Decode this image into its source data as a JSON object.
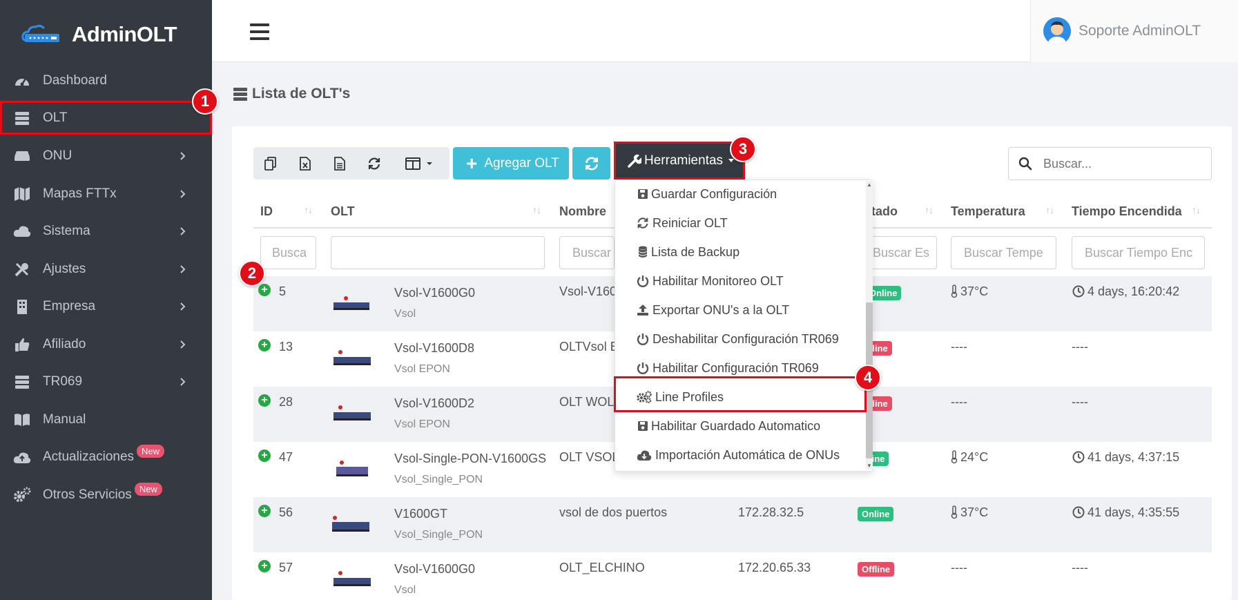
{
  "app": {
    "brand": "AdminOLT",
    "user_name": "Soporte AdminOLT"
  },
  "sidebar": {
    "items": [
      {
        "label": "Dashboard",
        "icon": "tachometer-icon"
      },
      {
        "label": "OLT",
        "icon": "server-icon"
      },
      {
        "label": "ONU",
        "icon": "router-icon"
      },
      {
        "label": "Mapas FTTx",
        "icon": "map-icon"
      },
      {
        "label": "Sistema",
        "icon": "cloud-icon"
      },
      {
        "label": "Ajustes",
        "icon": "tools-icon"
      },
      {
        "label": "Empresa",
        "icon": "building-icon"
      },
      {
        "label": "Afiliado",
        "icon": "thumbs-up-icon"
      },
      {
        "label": "TR069",
        "icon": "server-icon"
      },
      {
        "label": "Manual",
        "icon": "book-icon"
      },
      {
        "label": "Actualizaciones",
        "icon": "cloud-upload-icon",
        "badge": "New"
      },
      {
        "label": "Otros Servicios",
        "icon": "gears-icon",
        "badge": "New"
      }
    ]
  },
  "page": {
    "title": "Lista de OLT's"
  },
  "toolbar": {
    "add_label": "Agregar OLT",
    "tools_label": "Herramientas",
    "search_placeholder": "Buscar..."
  },
  "table": {
    "headers": {
      "id": "ID",
      "olt": "OLT",
      "nombre": "Nombre",
      "estado": "tado",
      "temperatura": "Temperatura",
      "tiempo": "Tiempo Encendida"
    },
    "filters": {
      "id": "Busca",
      "olt": "",
      "nombre": "Buscar",
      "estado": "Buscar Es",
      "temperatura": "Buscar Tempe",
      "tiempo": "Buscar Tiempo Enc"
    },
    "rows": [
      {
        "id": "5",
        "model": "Vsol-V1600G0",
        "brand": "Vsol",
        "nombre": "Vsol-V160",
        "ip": "",
        "status": "Online",
        "temp": "37°C",
        "uptime": "4 days, 16:20:42"
      },
      {
        "id": "13",
        "model": "Vsol-V1600D8",
        "brand": "Vsol EPON",
        "nombre": "OLTVsol E",
        "ip": "",
        "status": "fline",
        "temp": "----",
        "uptime": "----"
      },
      {
        "id": "28",
        "model": "Vsol-V1600D2",
        "brand": "Vsol EPON",
        "nombre": "OLT WOL",
        "ip": "",
        "status": "fline",
        "temp": "----",
        "uptime": "----"
      },
      {
        "id": "47",
        "model": "Vsol-Single-PON-V1600GS",
        "brand": "Vsol_Single_PON",
        "nombre": "OLT VSOL",
        "ip": "",
        "status": "line",
        "temp": "24°C",
        "uptime": "41 days, 4:37:15"
      },
      {
        "id": "56",
        "model": "V1600GT",
        "brand": "Vsol_Single_PON",
        "nombre": "vsol de dos puertos",
        "ip": "172.28.32.5",
        "status": "Online",
        "temp": "37°C",
        "uptime": "41 days, 4:35:55"
      },
      {
        "id": "57",
        "model": "Vsol-V1600G0",
        "brand": "Vsol",
        "nombre": "OLT_ELCHINO",
        "ip": "172.20.65.33",
        "status": "Offline",
        "temp": "----",
        "uptime": "----"
      }
    ]
  },
  "dropdown": {
    "items": [
      {
        "label": "Guardar Configuración",
        "icon": "floppy-icon"
      },
      {
        "label": "Reiniciar OLT",
        "icon": "refresh-icon"
      },
      {
        "label": "Lista de Backup",
        "icon": "database-icon"
      },
      {
        "label": "Habilitar Monitoreo OLT",
        "icon": "power-icon"
      },
      {
        "label": "Exportar ONU's a la OLT",
        "icon": "upload-icon"
      },
      {
        "label": "Deshabilitar Configuración TR069",
        "icon": "power-icon"
      },
      {
        "label": "Habilitar Configuración TR069",
        "icon": "power-icon"
      },
      {
        "label": "Line Profiles",
        "icon": "gears-icon"
      },
      {
        "label": "Habilitar Guardado Automatico",
        "icon": "floppy-icon"
      },
      {
        "label": "Importación Automática de ONUs",
        "icon": "cloud-download-icon"
      }
    ]
  },
  "callouts": [
    "1",
    "2",
    "3",
    "4"
  ],
  "colors": {
    "sidebar_bg": "#343a40",
    "accent_info": "#3fbfd8",
    "highlight_red": "#e10e19",
    "online": "#2dbe80",
    "offline": "#e84d66"
  }
}
